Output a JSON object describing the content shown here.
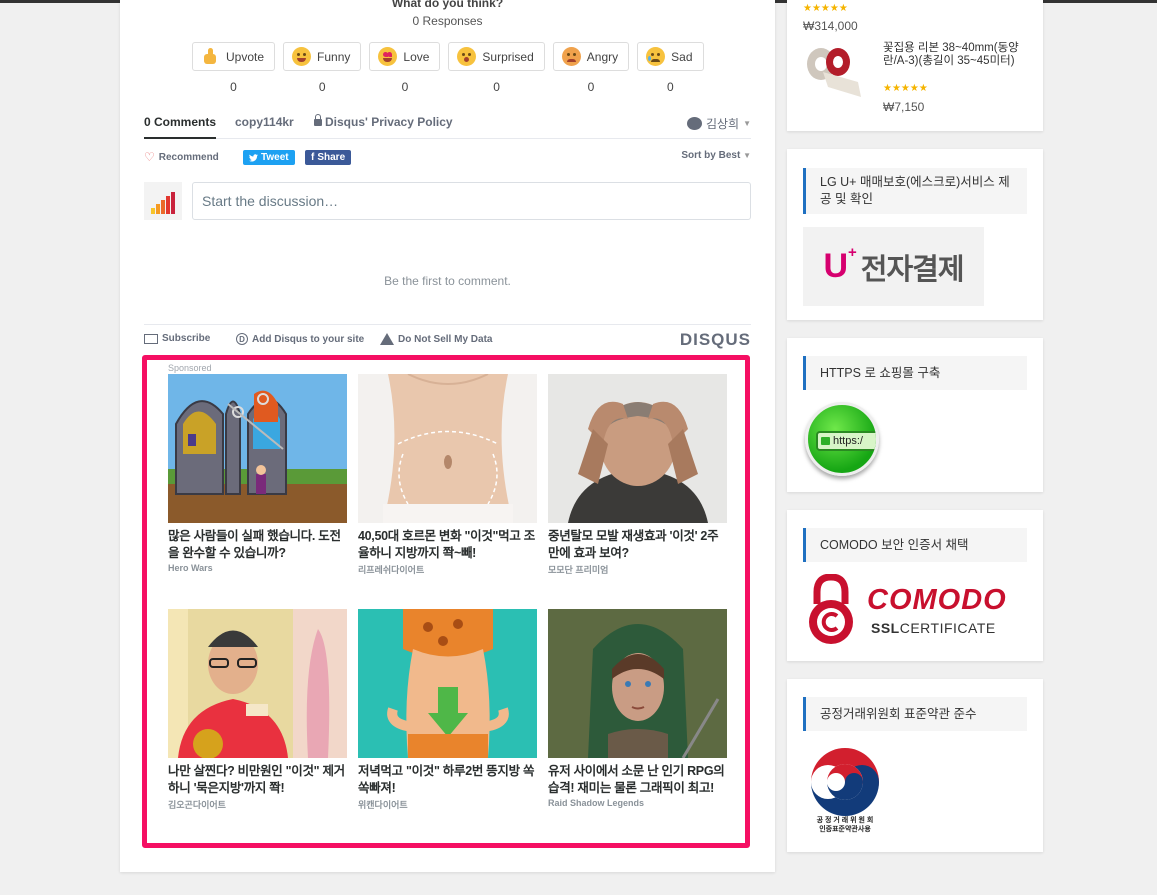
{
  "reactions_header": {
    "question": "What do you think?",
    "responses": "0 Responses"
  },
  "reactions": [
    {
      "label": "Upvote",
      "count": "0",
      "icon": "upvote-emoji-icon"
    },
    {
      "label": "Funny",
      "count": "0",
      "icon": "funny-emoji-icon"
    },
    {
      "label": "Love",
      "count": "0",
      "icon": "love-emoji-icon"
    },
    {
      "label": "Surprised",
      "count": "0",
      "icon": "surprised-emoji-icon"
    },
    {
      "label": "Angry",
      "count": "0",
      "icon": "angry-emoji-icon"
    },
    {
      "label": "Sad",
      "count": "0",
      "icon": "sad-emoji-icon"
    }
  ],
  "tabs": {
    "comments": "0 Comments",
    "site": "copy114kr",
    "privacy": "Disqus' Privacy Policy",
    "user": "김상희"
  },
  "actions": {
    "recommend": "Recommend",
    "tweet": "Tweet",
    "share": "Share",
    "sort": "Sort by Best"
  },
  "comment_box": {
    "placeholder": "Start the discussion…",
    "empty": "Be the first to comment."
  },
  "footer": {
    "subscribe": "Subscribe",
    "add_disqus": "Add Disqus to your site",
    "do_not_sell": "Do Not Sell My Data",
    "logo": "DISQUS"
  },
  "sponsored": {
    "label": "Sponsored",
    "ads": [
      {
        "title": "많은 사람들이 실패 했습니다. 도전을 완수할 수 있습니까?",
        "source": "Hero Wars"
      },
      {
        "title": "40,50대 호르몬 변화 \"이것\"먹고 조율하니 지방까지 쫙~빼!",
        "source": "리프레쉬다이어트"
      },
      {
        "title": "중년탈모 모발 재생효과 '이것' 2주만에 효과 보여?",
        "source": "모모단 프리미엄"
      },
      {
        "title": "나만 살찐다? 비만원인 \"이것\" 제거하니 '묵은지방'까지 쫙!",
        "source": "김오곤다이어트"
      },
      {
        "title": "저녁먹고 \"이것\" 하루2번 뜽지방 쏙쏙빠져!",
        "source": "위캔다이어트"
      },
      {
        "title": "유저 사이에서 소문 난 인기 RPG의 습격! 재미는 물론 그래픽이 최고!",
        "source": "Raid Shadow Legends"
      }
    ]
  },
  "sidebar": {
    "products": [
      {
        "price": "₩314,000"
      },
      {
        "name": "꽃집용 리본 38~40mm(동양란/A-3)(총길이 35~45미터)",
        "price": "₩7,150"
      }
    ],
    "widgets": [
      {
        "title": "LG U+ 매매보호(에스크로)서비스 제공 및 확인",
        "logo_text": "전자결제",
        "logo_prefix": "U"
      },
      {
        "title": "HTTPS 로 쇼핑몰 구축",
        "badge": "https:/"
      },
      {
        "title": "COMODO 보안 인증서 채택",
        "logo_main": "COMODO",
        "logo_sub_bold": "SSL",
        "logo_sub": "CERTIFICATE"
      },
      {
        "title": "공정거래위원회 표준약관 준수",
        "caption_1": "공 정 거 래 위 원 회",
        "caption_2": "인증표준약관사용"
      }
    ]
  },
  "colors": {
    "sponsored_border": "#f50f63",
    "tweet": "#1da1f2",
    "facebook": "#3b5998",
    "sidebar_accent": "#1f70c1",
    "comodo_red": "#c8102e",
    "lg_magenta": "#d6006f"
  }
}
